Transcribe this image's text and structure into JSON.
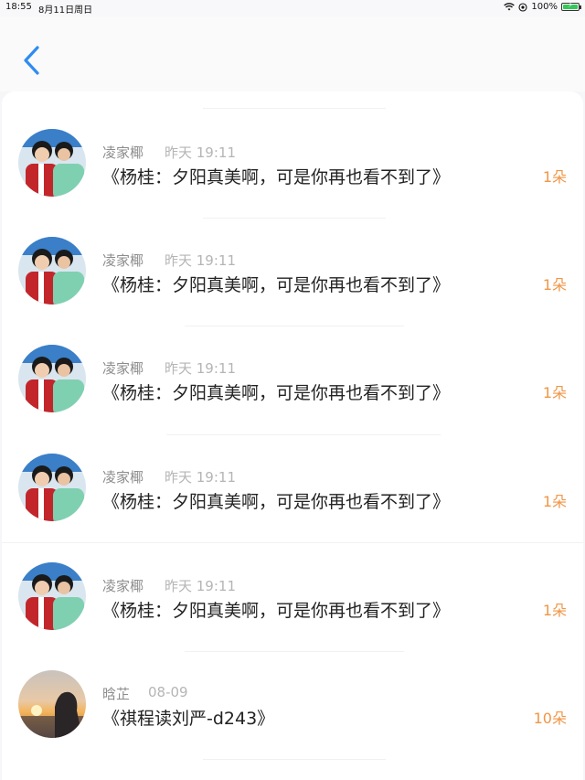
{
  "status": {
    "time": "18:55",
    "date": "8月11日周日",
    "battery": "100%",
    "icons": [
      "wifi-icon",
      "location-icon",
      "battery-icon"
    ]
  },
  "nav": {
    "back_icon": "chevron-left-icon"
  },
  "items": [
    {
      "name": "凌家椰",
      "time": "昨天 19:11",
      "title": "《杨桂：夕阳真美啊，可是你再也看不到了》",
      "count": "1朵"
    },
    {
      "name": "凌家椰",
      "time": "昨天 19:11",
      "title": "《杨桂：夕阳真美啊，可是你再也看不到了》",
      "count": "1朵"
    },
    {
      "name": "凌家椰",
      "time": "昨天 19:11",
      "title": "《杨桂：夕阳真美啊，可是你再也看不到了》",
      "count": "1朵"
    },
    {
      "name": "凌家椰",
      "time": "昨天 19:11",
      "title": "《杨桂：夕阳真美啊，可是你再也看不到了》",
      "count": "1朵"
    },
    {
      "name": "凌家椰",
      "time": "昨天 19:11",
      "title": "《杨桂：夕阳真美啊，可是你再也看不到了》",
      "count": "1朵"
    },
    {
      "name": "晗芷",
      "time": "08-09",
      "title": "《祺程读刘严-d243》",
      "count": "10朵"
    }
  ],
  "colors": {
    "accent": "#2f8cf0",
    "count": "#f09646"
  }
}
